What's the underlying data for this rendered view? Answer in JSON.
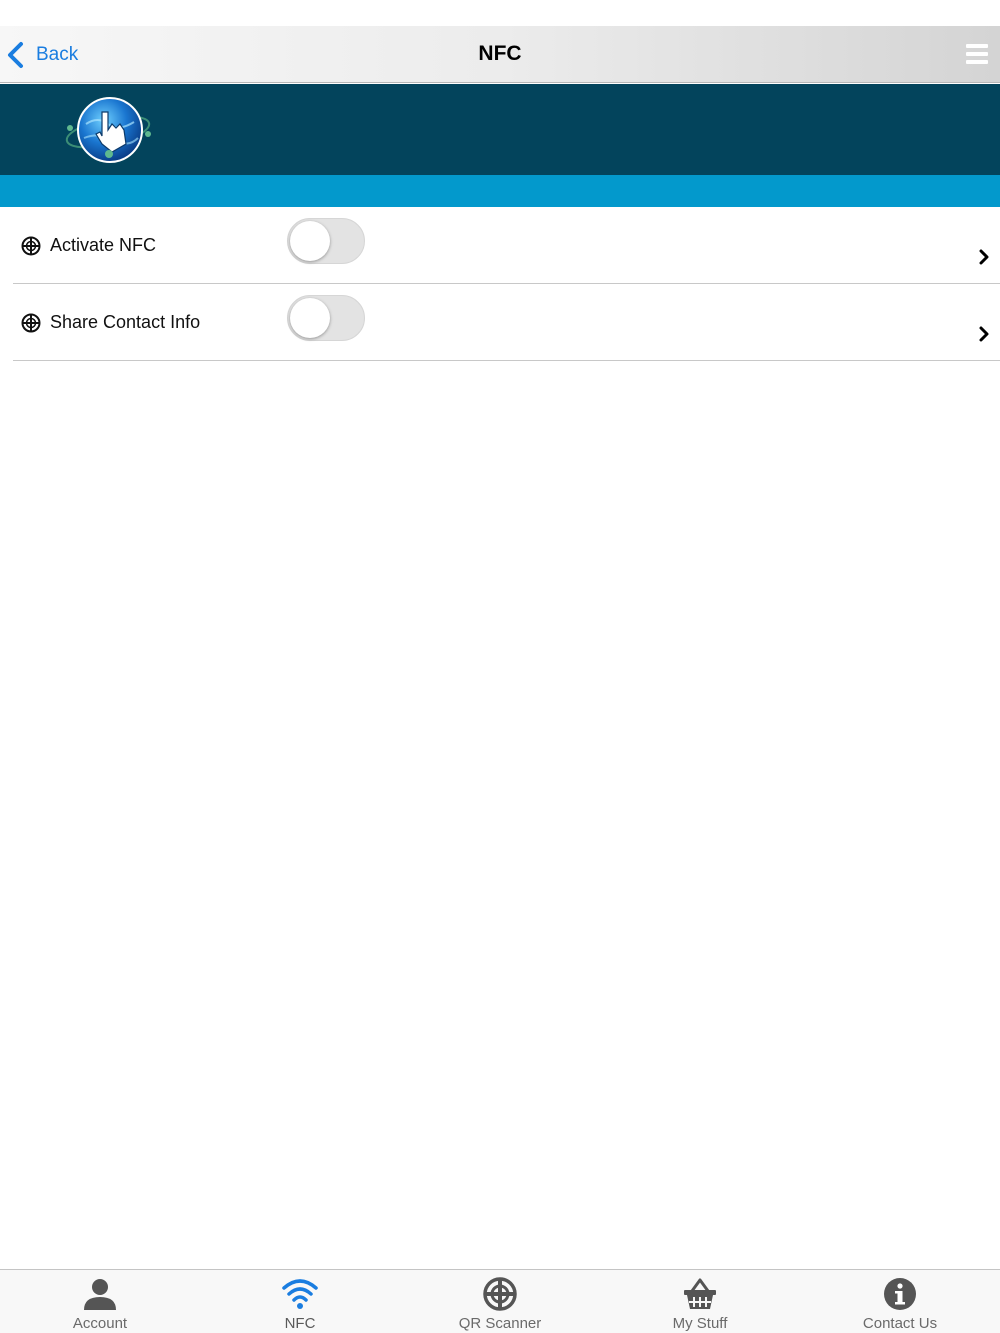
{
  "navbar": {
    "back_label": "Back",
    "title": "NFC",
    "back_icon": "chevron-left-icon",
    "menu_icon": "hamburger-menu-icon"
  },
  "banner": {
    "logo": "globe-hand-logo"
  },
  "colors": {
    "nav_link": "#1a7de0",
    "banner": "#03445c",
    "accent_bar": "#0399cc",
    "active_tab_icon": "#1a7de0",
    "inactive_tab_icon": "#555555"
  },
  "settings": [
    {
      "label": "Activate NFC",
      "icon": "crosshair-icon",
      "toggle_on": false
    },
    {
      "label": "Share Contact Info",
      "icon": "crosshair-icon",
      "toggle_on": false
    }
  ],
  "tabbar": {
    "active": "NFC",
    "tabs": [
      {
        "label": "Account",
        "icon": "person-icon"
      },
      {
        "label": "NFC",
        "icon": "wifi-icon"
      },
      {
        "label": "QR Scanner",
        "icon": "crosshair-icon"
      },
      {
        "label": "My Stuff",
        "icon": "basket-icon"
      },
      {
        "label": "Contact Us",
        "icon": "info-icon"
      }
    ]
  }
}
